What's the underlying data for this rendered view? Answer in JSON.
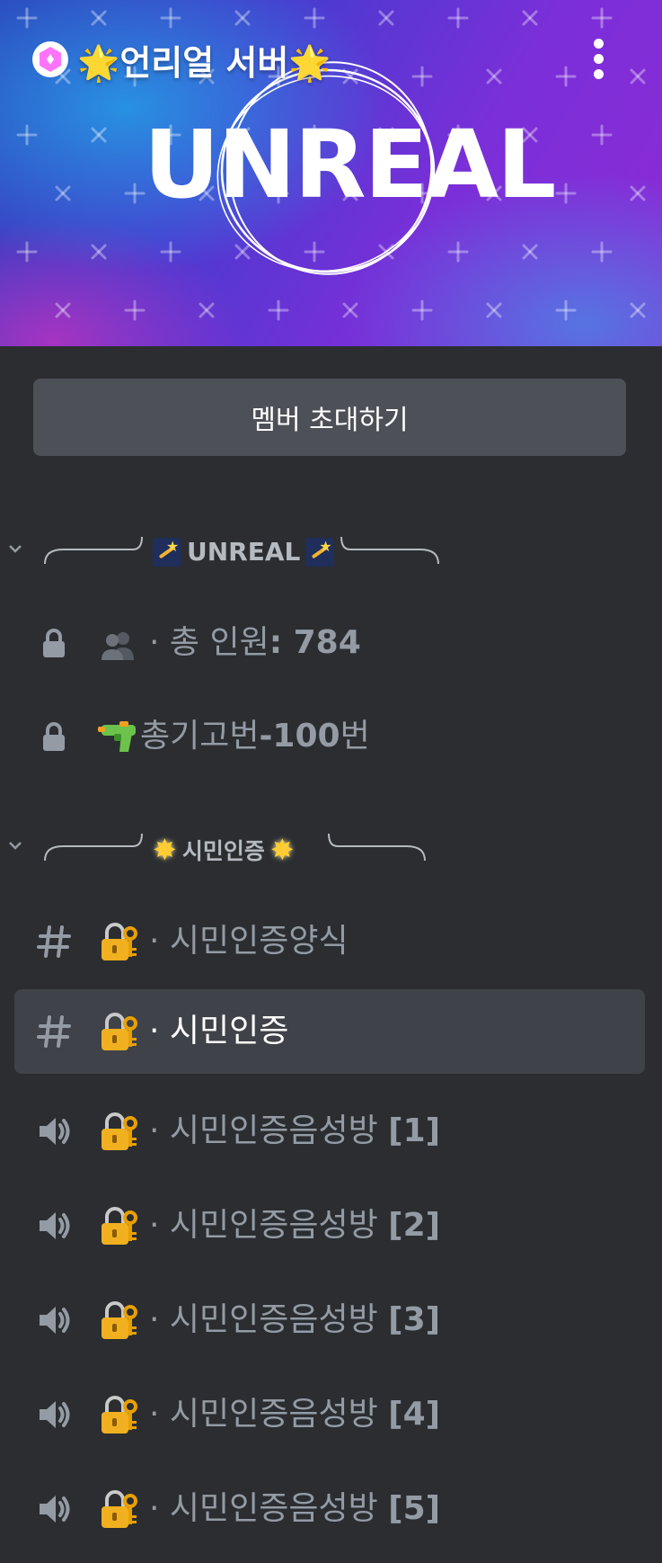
{
  "server": {
    "name": "🌟언리얼 서버🌟",
    "banner_text": "UNREAL"
  },
  "invite_button": {
    "label": "멤버 초대하기"
  },
  "categories": [
    {
      "label": "UNREAL",
      "emoji": "shooting-star"
    },
    {
      "label": "시민인증",
      "emoji": "glowing-star"
    }
  ],
  "channels": [
    {
      "type": "locked",
      "emoji": "people-silhouette-icon",
      "prefix": "· 총 인원",
      "suffix": ": 784"
    },
    {
      "type": "locked",
      "emoji": "water-pistol-icon",
      "prefix": "총기고번",
      "suffix": "-100",
      "tail": "번"
    },
    {
      "type": "text",
      "emoji": "lock-with-key-icon",
      "name": "· 시민인증양식"
    },
    {
      "type": "text",
      "emoji": "lock-with-key-icon",
      "name": "· 시민인증",
      "selected": true
    },
    {
      "type": "voice",
      "emoji": "lock-with-key-icon",
      "name": "· 시민인증음성방 ",
      "suffix": "[1]"
    },
    {
      "type": "voice",
      "emoji": "lock-with-key-icon",
      "name": "· 시민인증음성방 ",
      "suffix": "[2]"
    },
    {
      "type": "voice",
      "emoji": "lock-with-key-icon",
      "name": "· 시민인증음성방 ",
      "suffix": "[3]"
    },
    {
      "type": "voice",
      "emoji": "lock-with-key-icon",
      "name": "· 시민인증음성방 ",
      "suffix": "[4]"
    },
    {
      "type": "voice",
      "emoji": "lock-with-key-icon",
      "name": "· 시민인증음성방 ",
      "suffix": "[5]"
    }
  ],
  "colors": {
    "background": "#2b2d31",
    "selected_row": "#404249",
    "button": "#4e5058",
    "muted_text": "#949ba4",
    "boost_pink": "#ff73fa"
  }
}
